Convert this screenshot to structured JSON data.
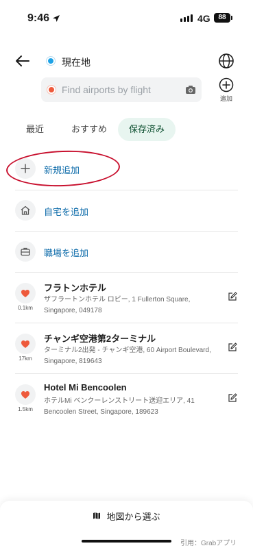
{
  "status_bar": {
    "time": "9:46",
    "network": "4G",
    "battery": "88"
  },
  "header": {
    "origin_label": "現在地",
    "search": {
      "placeholder": "Find airports by flight",
      "value": ""
    },
    "add_label": "追加"
  },
  "tabs": [
    {
      "label": "最近",
      "active": false
    },
    {
      "label": "おすすめ",
      "active": false
    },
    {
      "label": "保存済み",
      "active": true
    }
  ],
  "actions": {
    "new_label": "新規追加",
    "home_label": "自宅を追加",
    "work_label": "職場を追加"
  },
  "saved": [
    {
      "name": "フラトンホテル",
      "address": "ザフラートンホテル ロビー, 1 Fullerton Square, Singapore, 049178",
      "distance": "0.1km"
    },
    {
      "name": "チャンギ空港第2ターミナル",
      "address": "ターミナル2出発 - チャンギ空港, 60 Airport Boulevard, Singapore, 819643",
      "distance": "17km"
    },
    {
      "name": "Hotel Mi Bencoolen",
      "address": "ホテルMi ベンクーレンストリート送迎エリア, 41 Bencoolen Street, Singapore, 189623",
      "distance": "1.5km"
    }
  ],
  "bottom": {
    "map_label": "地図から選ぶ"
  },
  "credit": "引用：Grabアプリ",
  "colors": {
    "accent_link": "#0b6aa9",
    "tab_active_bg": "#e8f5f0",
    "heart": "#ee5a3c",
    "origin_dot": "#1ea2e6",
    "annotation": "#c8102e"
  }
}
